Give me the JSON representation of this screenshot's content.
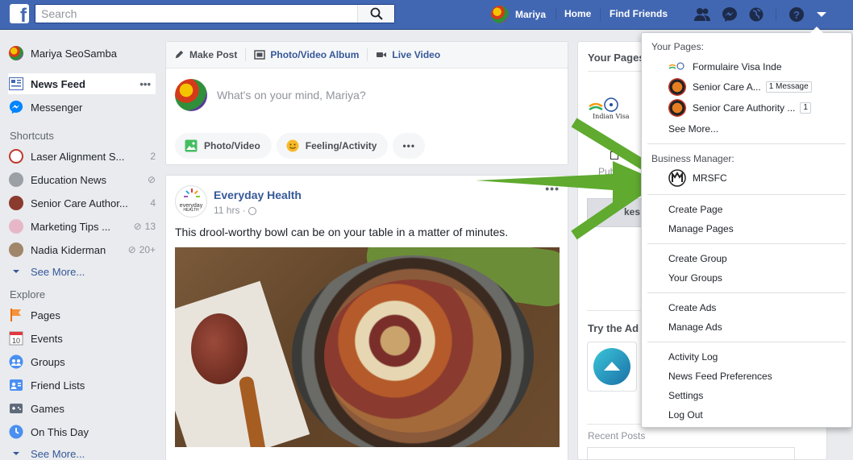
{
  "topbar": {
    "search_placeholder": "Search",
    "user_name": "Mariya",
    "home": "Home",
    "find_friends": "Find Friends",
    "brand_color": "#4267b2"
  },
  "sidebar": {
    "profile_name": "Mariya SeoSamba",
    "news_feed": "News Feed",
    "news_feed_more": "•••",
    "messenger": "Messenger",
    "shortcuts_header": "Shortcuts",
    "shortcuts": [
      {
        "label": "Laser Alignment S...",
        "count": "2",
        "icon": "laser-page-icon"
      },
      {
        "label": "Education News",
        "count": "",
        "icon": "education-page-icon"
      },
      {
        "label": "Senior Care Author...",
        "count": "4",
        "icon": "senior-care-page-icon"
      },
      {
        "label": "Marketing Tips ...",
        "count": "13",
        "icon": "marketing-page-icon"
      },
      {
        "label": "Nadia Kiderman",
        "count": "20+",
        "icon": "nadia-icon"
      }
    ],
    "shortcuts_see_more": "See More...",
    "explore_header": "Explore",
    "explore": [
      {
        "label": "Pages",
        "icon": "flag-icon"
      },
      {
        "label": "Events",
        "icon": "calendar-icon"
      },
      {
        "label": "Groups",
        "icon": "groups-icon"
      },
      {
        "label": "Friend Lists",
        "icon": "friend-list-icon"
      },
      {
        "label": "Games",
        "icon": "games-icon"
      },
      {
        "label": "On This Day",
        "icon": "clock-icon"
      }
    ],
    "explore_see_more": "See More...",
    "calendar_day": "10"
  },
  "composer": {
    "tabs": [
      "Make Post",
      "Photo/Video Album",
      "Live Video"
    ],
    "placeholder": "What's on your mind, Mariya?",
    "pills": [
      "Photo/Video",
      "Feeling/Activity"
    ],
    "more": "•••"
  },
  "post": {
    "page_name": "Everyday Health",
    "logo_text": "everyday",
    "logo_sub": "HEALTH",
    "time": "11 hrs ·",
    "more": "•••",
    "text": "This drool-worthy bowl can be on your table in a matter of minutes."
  },
  "right_column": {
    "your_pages": "Your Pages",
    "publish": "Publish",
    "likes": "kes",
    "try_the_ad": "Try the Ad",
    "recent_posts": "Recent Posts",
    "indian_visa_logo": "Indian Visa"
  },
  "dropdown": {
    "your_pages_header": "Your Pages:",
    "pages": [
      {
        "name": "Formulaire Visa Inde",
        "badge": ""
      },
      {
        "name": "Senior Care A...",
        "badge": "1 Message"
      },
      {
        "name": "Senior Care Authority ...",
        "badge": "1"
      }
    ],
    "see_more": "See More...",
    "business_header": "Business Manager:",
    "business": "MRSFC",
    "group1": [
      "Create Page",
      "Manage Pages"
    ],
    "group2": [
      "Create Group",
      "Your Groups"
    ],
    "group3": [
      "Create Ads",
      "Manage Ads"
    ],
    "group4": [
      "Activity Log",
      "News Feed Preferences",
      "Settings",
      "Log Out"
    ]
  },
  "arrow_color": "#5faa2f"
}
